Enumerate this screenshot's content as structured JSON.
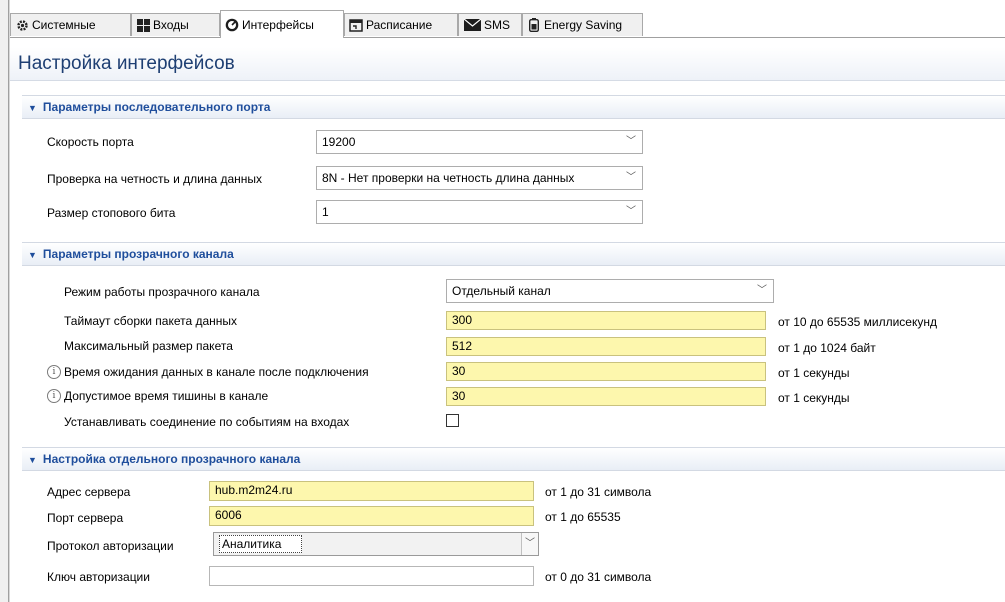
{
  "tabs": [
    {
      "label": "Системные",
      "icon": "gear-icon"
    },
    {
      "label": "Входы",
      "icon": "grid-icon"
    },
    {
      "label": "Интерфейсы",
      "icon": "gauge-icon"
    },
    {
      "label": "Расписание",
      "icon": "calendar-icon"
    },
    {
      "label": "SMS",
      "icon": "envelope-icon"
    },
    {
      "label": "Energy Saving",
      "icon": "battery-icon"
    }
  ],
  "active_tab": "Интерфейсы",
  "page_title": "Настройка интерфейсов",
  "serial": {
    "header": "Параметры последовательного порта",
    "speed_label": "Скорость порта",
    "speed_value": "19200",
    "parity_label": "Проверка на четность и длина данных",
    "parity_value": "8N - Нет проверки на четность длина данных",
    "stopbit_label": "Размер стопового бита",
    "stopbit_value": "1"
  },
  "transparent": {
    "header": "Параметры прозрачного канала",
    "mode_label": "Режим работы прозрачного канала",
    "mode_value": "Отдельный канал",
    "timeout_label": "Таймаут сборки пакета данных",
    "timeout_value": "300",
    "timeout_hint": "от 10 до 65535 миллисекунд",
    "maxsize_label": "Максимальный размер пакета",
    "maxsize_value": "512",
    "maxsize_hint": "от 1 до 1024 байт",
    "wait_label": "Время ожидания данных в канале после подключения",
    "wait_value": "30",
    "wait_hint": "от 1 секунды",
    "silence_label": "Допустимое время тишины в канале",
    "silence_value": "30",
    "silence_hint": "от 1 секунды",
    "events_label": "Устанавливать соединение по событиям на входах",
    "events_checked": false
  },
  "separate": {
    "header": "Настройка отдельного прозрачного канала",
    "server_label": "Адрес сервера",
    "server_value": "hub.m2m24.ru",
    "server_hint": "от 1 до 31 символа",
    "port_label": "Порт сервера",
    "port_value": "6006",
    "port_hint": "от 1 до 65535",
    "auth_proto_label": "Протокол авторизации",
    "auth_proto_value": "Аналитика",
    "auth_key_label": "Ключ авторизации",
    "auth_key_value": "",
    "auth_key_hint": "от 0 до 31 символа"
  },
  "colors": {
    "accent": "#1f4e9c",
    "title": "#1e3f73",
    "field_fill": "#fdf7ad"
  }
}
